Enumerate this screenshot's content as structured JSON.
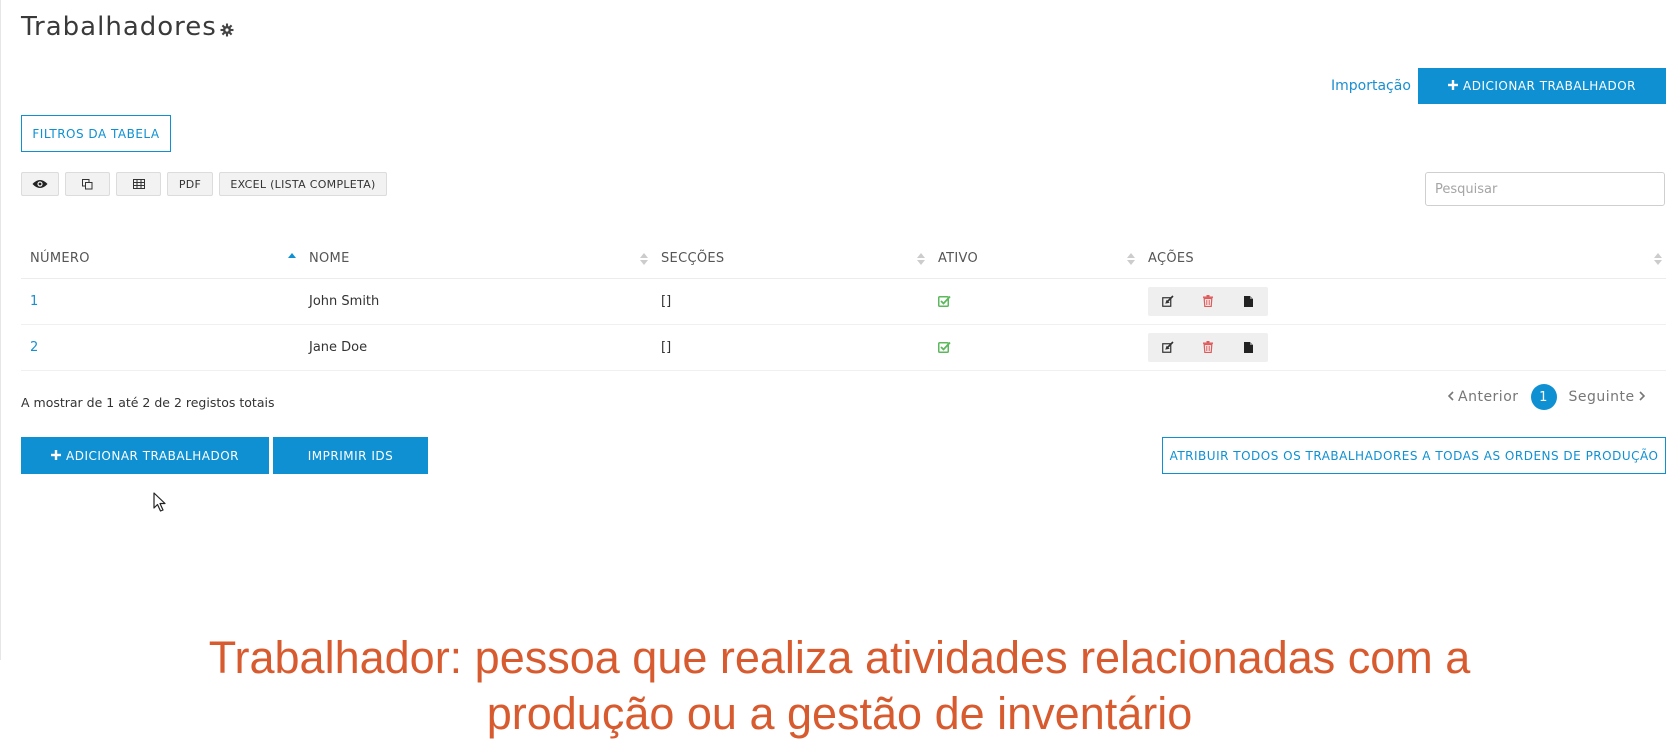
{
  "header": {
    "title": "Trabalhadores",
    "settings_icon": "gear-icon"
  },
  "top_actions": {
    "import_link": "Importação",
    "add_worker": "ADICIONAR TRABALHADOR",
    "add_icon": "plus-icon"
  },
  "filters": {
    "label": "FILTROS DA TABELA"
  },
  "toolbar": {
    "buttons": [
      {
        "name": "column-visibility",
        "icon": "eye-icon"
      },
      {
        "name": "copy",
        "icon": "copy-icon"
      },
      {
        "name": "csv",
        "icon": "table-icon"
      },
      {
        "name": "pdf",
        "label": "PDF"
      },
      {
        "name": "excel",
        "label": "EXCEL (LISTA COMPLETA)"
      }
    ]
  },
  "search": {
    "placeholder": "Pesquisar",
    "value": ""
  },
  "table": {
    "columns": [
      "NÚMERO",
      "NOME",
      "SECÇÕES",
      "ATIVO",
      "AÇÕES"
    ],
    "sorted_column": "NÚMERO",
    "sort_direction": "ascending",
    "rows": [
      {
        "numero": "1",
        "nome": "John Smith",
        "seccoes": "[]",
        "ativo": true
      },
      {
        "numero": "2",
        "nome": "Jane Doe",
        "seccoes": "[]",
        "ativo": true
      }
    ],
    "row_actions": [
      "edit-icon",
      "trash-icon",
      "document-icon"
    ]
  },
  "info": {
    "text": "A mostrar de 1 até 2 de 2 registos totais"
  },
  "pagination": {
    "previous": "Anterior",
    "current": "1",
    "next": "Seguinte"
  },
  "bottom_actions": {
    "add_worker": "ADICIONAR TRABALHADOR",
    "print_ids": "IMPRIMIR IDS",
    "assign_all": "ATRIBUIR TODOS OS TRABALHADORES A TODAS AS ORDENS DE PRODUÇÃO"
  },
  "caption": {
    "line1": "Trabalhador: pessoa que realiza atividades relacionadas com a",
    "line2": "produção ou a gestão de inventário"
  },
  "colors": {
    "primary": "#0e90d2",
    "link": "#1a8fd0",
    "active_check": "#5cb85c",
    "delete": "#e05a5a",
    "caption": "#d85b2f"
  }
}
